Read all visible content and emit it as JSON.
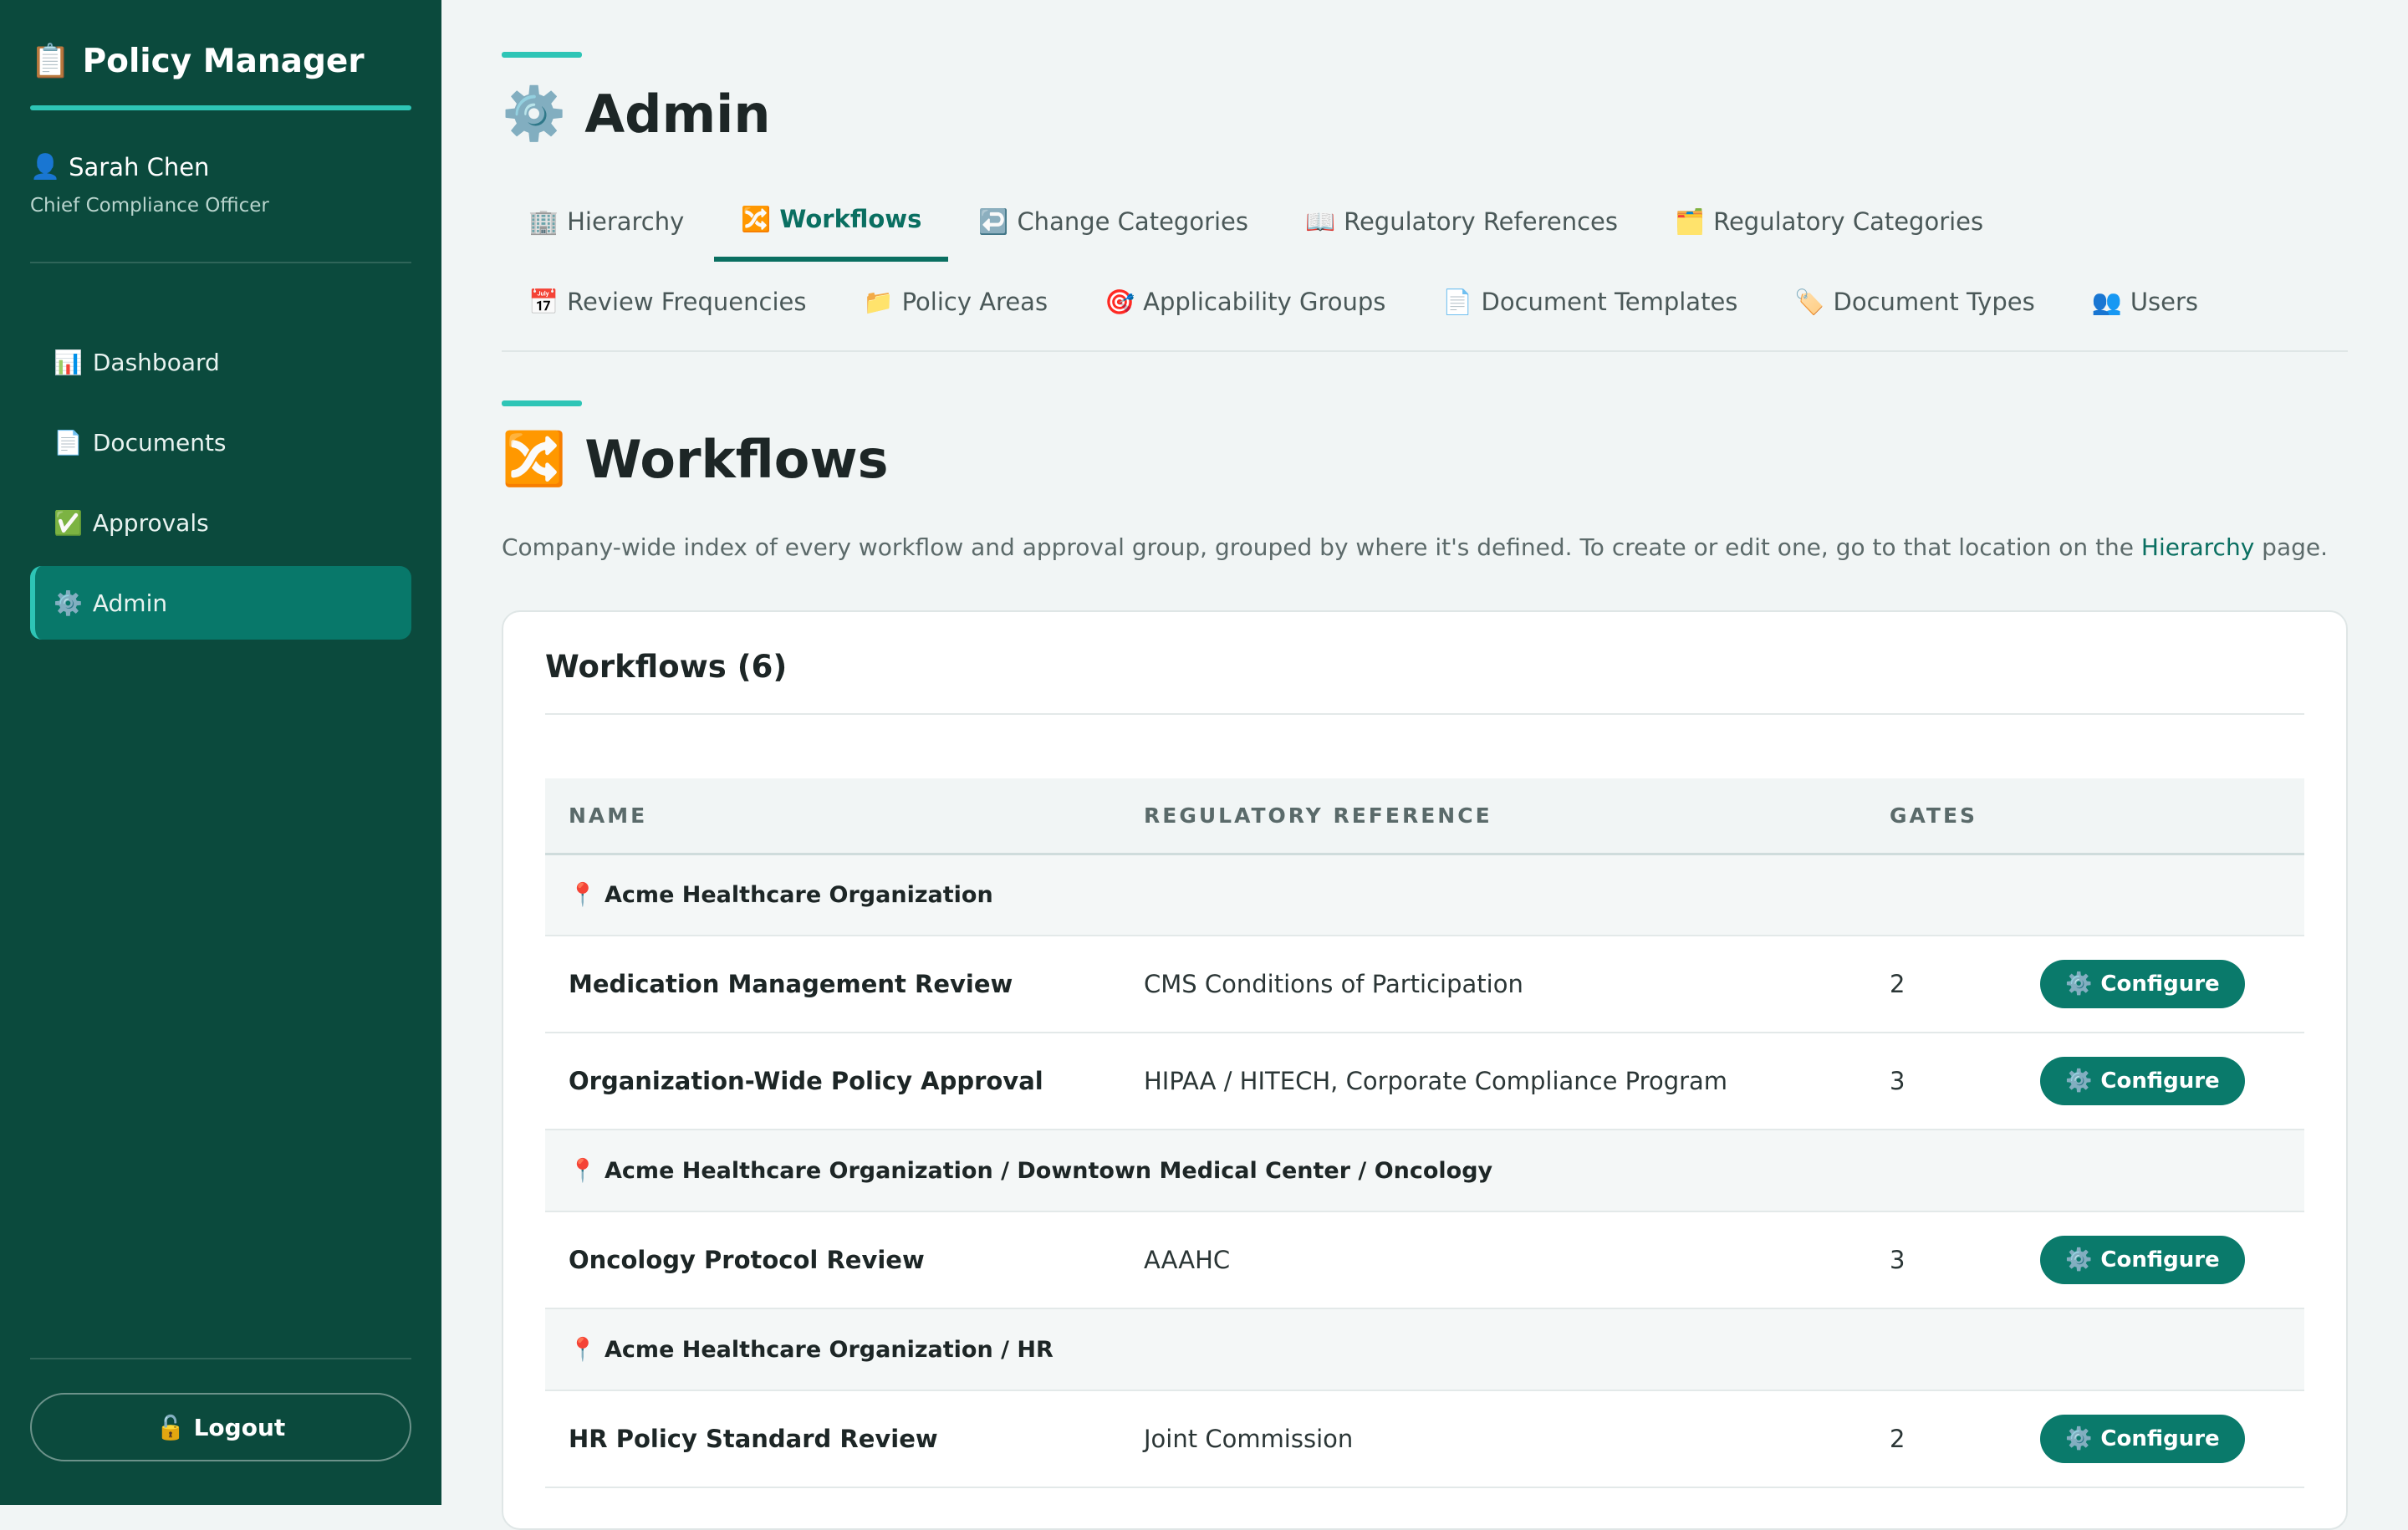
{
  "sidebar": {
    "brand": {
      "icon": "📋",
      "label": "Policy Manager"
    },
    "user": {
      "icon": "👤",
      "name": "Sarah Chen",
      "role": "Chief Compliance Officer"
    },
    "nav": [
      {
        "icon": "📊",
        "label": "Dashboard",
        "active": false
      },
      {
        "icon": "📄",
        "label": "Documents",
        "active": false
      },
      {
        "icon": "✅",
        "label": "Approvals",
        "active": false
      },
      {
        "icon": "⚙️",
        "label": "Admin",
        "active": true
      }
    ],
    "logout": {
      "icon": "🔓",
      "label": "Logout"
    }
  },
  "page": {
    "icon": "⚙️",
    "title": "Admin"
  },
  "tabs": [
    {
      "icon": "🏢",
      "label": "Hierarchy",
      "active": false
    },
    {
      "icon": "🔀",
      "label": "Workflows",
      "active": true
    },
    {
      "icon": "↩️",
      "label": "Change Categories",
      "active": false
    },
    {
      "icon": "📖",
      "label": "Regulatory References",
      "active": false
    },
    {
      "icon": "🗂️",
      "label": "Regulatory Categories",
      "active": false
    },
    {
      "icon": "📅",
      "label": "Review Frequencies",
      "active": false
    },
    {
      "icon": "📁",
      "label": "Policy Areas",
      "active": false
    },
    {
      "icon": "🎯",
      "label": "Applicability Groups",
      "active": false
    },
    {
      "icon": "📄",
      "label": "Document Templates",
      "active": false
    },
    {
      "icon": "🏷️",
      "label": "Document Types",
      "active": false
    },
    {
      "icon": "👥",
      "label": "Users",
      "active": false
    }
  ],
  "section": {
    "icon": "🔀",
    "title": "Workflows",
    "desc_before": "Company-wide index of every workflow and approval group, grouped by where it's defined. To create or edit one, go to that location on the ",
    "desc_link": "Hierarchy",
    "desc_after": " page."
  },
  "card": {
    "title": "Workflows (6)",
    "columns": {
      "name": "NAME",
      "reference": "REGULATORY REFERENCE",
      "gates": "GATES"
    },
    "configure_label": "Configure",
    "configure_icon": "⚙️",
    "location_icon": "📍",
    "groups": [
      {
        "location": "Acme Healthcare Organization",
        "rows": [
          {
            "name": "Medication Management Review",
            "reference": "CMS Conditions of Participation",
            "gates": "2"
          },
          {
            "name": "Organization-Wide Policy Approval",
            "reference": "HIPAA / HITECH, Corporate Compliance Program",
            "gates": "3"
          }
        ]
      },
      {
        "location": "Acme Healthcare Organization / Downtown Medical Center / Oncology",
        "rows": [
          {
            "name": "Oncology Protocol Review",
            "reference": "AAAHC",
            "gates": "3"
          }
        ]
      },
      {
        "location": "Acme Healthcare Organization / HR",
        "rows": [
          {
            "name": "HR Policy Standard Review",
            "reference": "Joint Commission",
            "gates": "2"
          }
        ]
      }
    ]
  },
  "colors": {
    "sidebar": "#0b4a3d",
    "accent": "#2ec5b6",
    "primary": "#0a7a6b"
  }
}
